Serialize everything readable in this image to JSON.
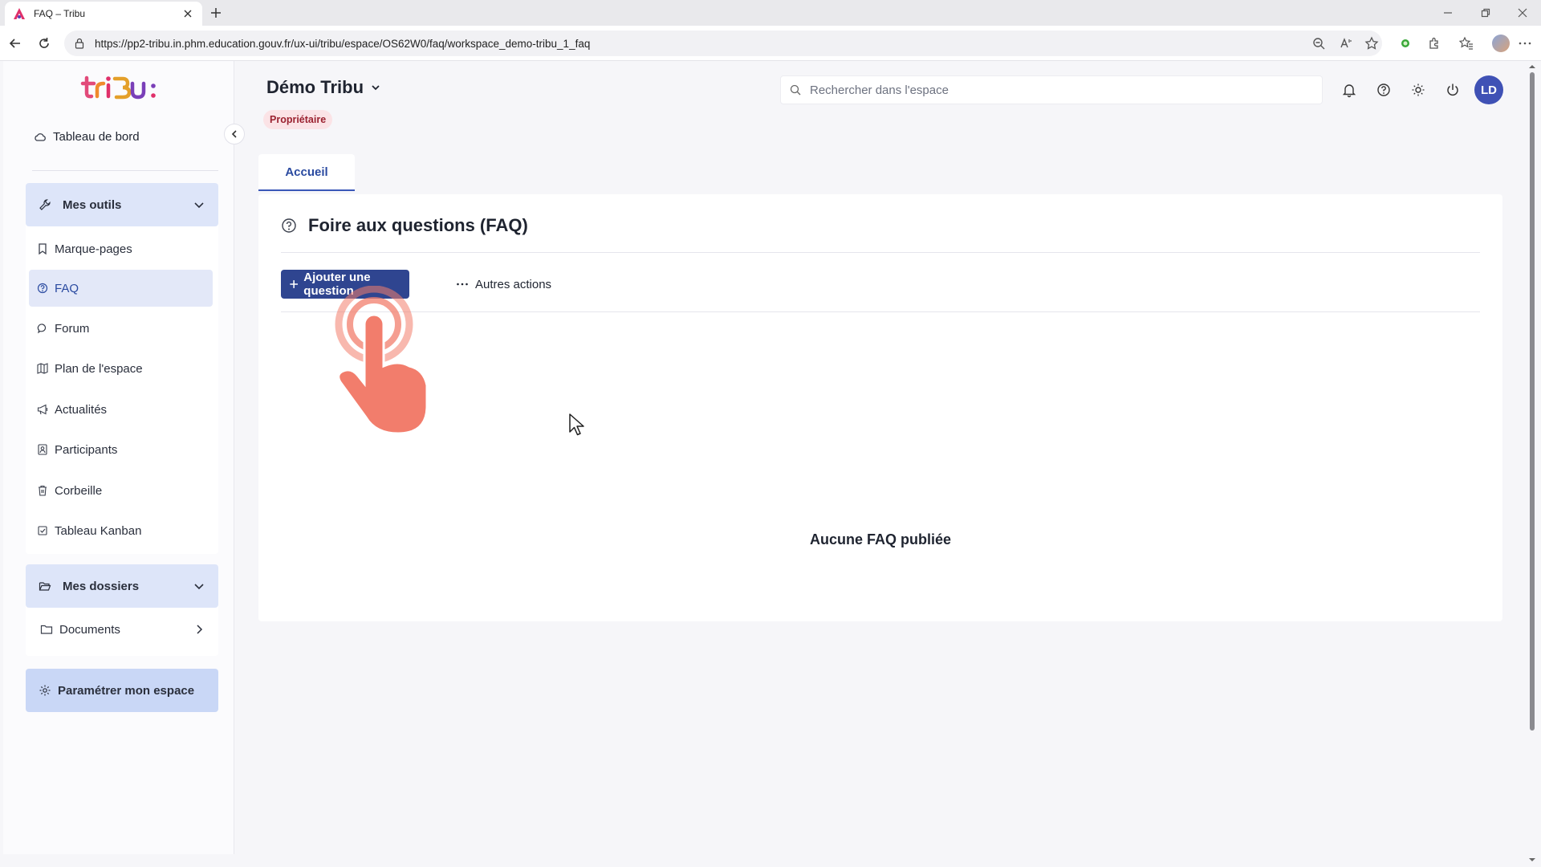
{
  "browser": {
    "tab_title": "FAQ – Tribu",
    "url": "https://pp2-tribu.in.phm.education.gouv.fr/ux-ui/tribu/espace/OS62W0/faq/workspace_demo-tribu_1_faq",
    "favicon_color": "#e0306a"
  },
  "sidebar": {
    "dashboard_label": "Tableau de bord",
    "tools": {
      "header": "Mes outils",
      "items": [
        {
          "label": "Marque-pages",
          "icon": "bookmark-icon"
        },
        {
          "label": "FAQ",
          "icon": "question-circle-icon",
          "active": true
        },
        {
          "label": "Forum",
          "icon": "chat-icon"
        },
        {
          "label": "Plan de l'espace",
          "icon": "map-icon"
        },
        {
          "label": "Actualités",
          "icon": "megaphone-icon"
        },
        {
          "label": "Participants",
          "icon": "contacts-icon"
        },
        {
          "label": "Corbeille",
          "icon": "trash-icon"
        },
        {
          "label": "Tableau Kanban",
          "icon": "checkbox-icon"
        }
      ]
    },
    "folders": {
      "header": "Mes dossiers",
      "items": [
        {
          "label": "Documents",
          "icon": "folder-icon"
        }
      ]
    },
    "settings_label": "Paramétrer mon espace"
  },
  "header": {
    "space_title": "Démo Tribu",
    "role_badge": "Propriétaire",
    "search_placeholder": "Rechercher dans l'espace",
    "avatar_initials": "LD"
  },
  "main": {
    "tab_label": "Accueil",
    "title": "Foire aux questions (FAQ)",
    "add_button_label": "Ajouter une question",
    "other_actions_label": "Autres actions",
    "empty_message": "Aucune FAQ publiée"
  },
  "colors": {
    "primary": "#2f4590",
    "accent_light": "#dde5f9",
    "badge_bg": "#fbe3e6",
    "badge_text": "#9b2230",
    "hand_overlay": "#f27d6c"
  }
}
